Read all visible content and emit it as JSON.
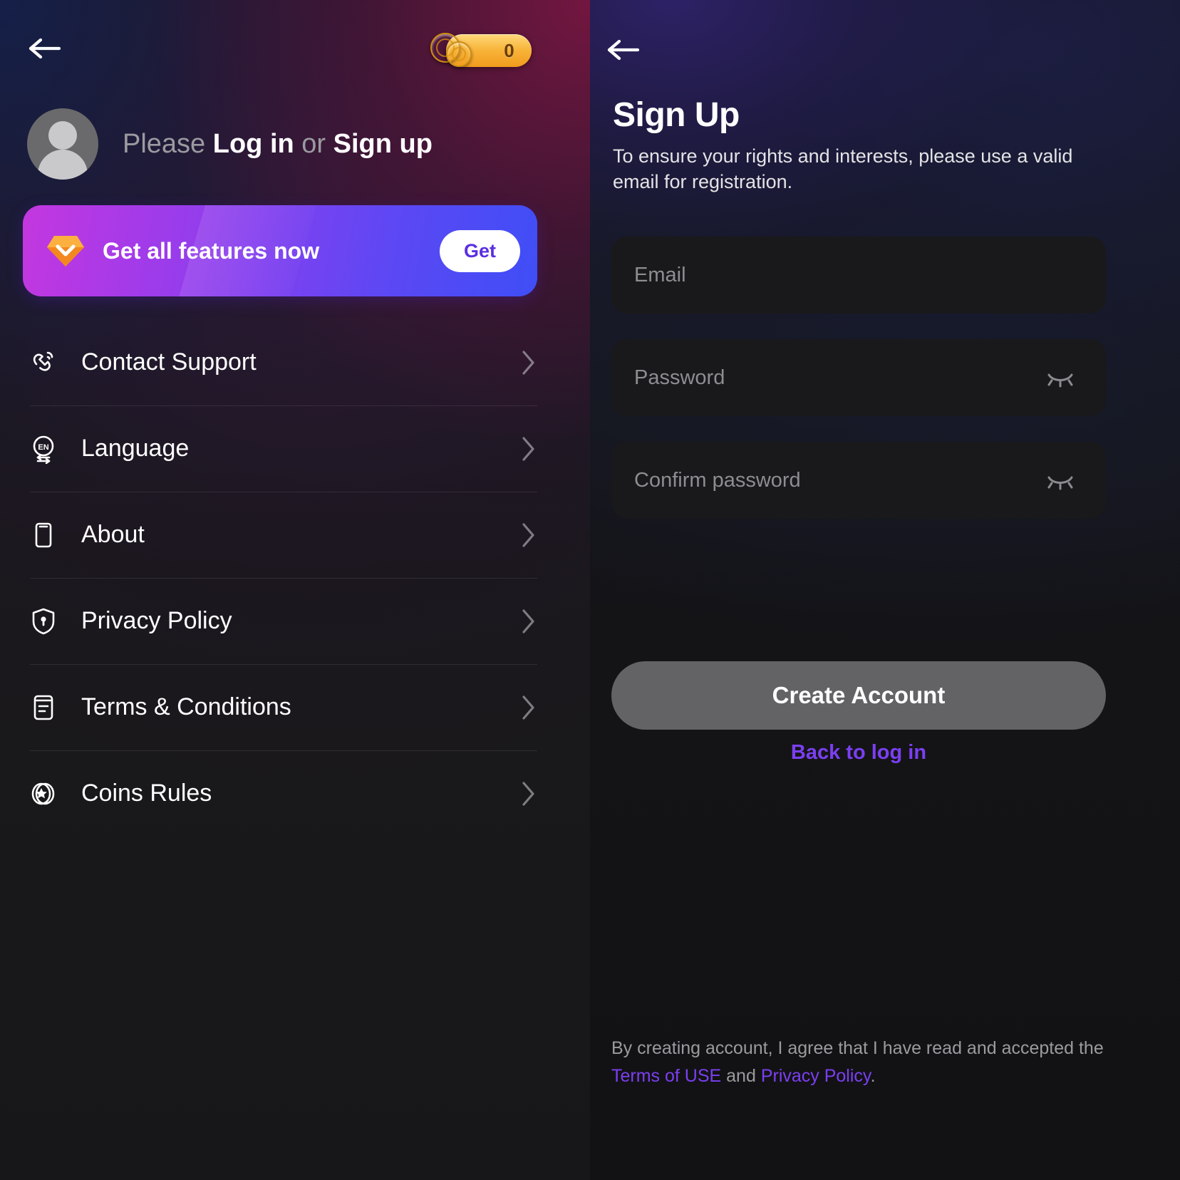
{
  "left_panel": {
    "back_icon": "arrow-left-icon",
    "coins": {
      "icon": "coin-stack-icon",
      "count": "0"
    },
    "account": {
      "avatar_icon": "user-avatar-placeholder-icon",
      "prefix": "Please ",
      "login_label": "Log in",
      "separator": " or ",
      "signup_label": "Sign up"
    },
    "promo": {
      "icon": "diamond-gem-icon",
      "label": "Get all features now",
      "button_label": "Get"
    },
    "menu": [
      {
        "icon": "headset-support-icon",
        "label": "Contact Support",
        "chevron": "chevron-right-icon"
      },
      {
        "icon": "language-en-icon",
        "label": "Language",
        "chevron": "chevron-right-icon"
      },
      {
        "icon": "phone-device-icon",
        "label": "About",
        "chevron": "chevron-right-icon"
      },
      {
        "icon": "shield-lock-icon",
        "label": "Privacy Policy",
        "chevron": "chevron-right-icon"
      },
      {
        "icon": "document-lines-icon",
        "label": "Terms & Conditions",
        "chevron": "chevron-right-icon"
      },
      {
        "icon": "coin-star-icon",
        "label": "Coins Rules",
        "chevron": "chevron-right-icon"
      }
    ]
  },
  "right_panel": {
    "back_icon": "arrow-left-icon",
    "title": "Sign Up",
    "subtitle": "To ensure your rights and interests, please use a valid email for registration.",
    "fields": {
      "email": {
        "placeholder": "Email",
        "value": ""
      },
      "password": {
        "placeholder": "Password",
        "value": "",
        "toggle_icon": "eye-off-icon"
      },
      "confirm": {
        "placeholder": "Confirm password",
        "value": "",
        "toggle_icon": "eye-off-icon"
      }
    },
    "create_button": "Create Account",
    "back_to_login": "Back to log in",
    "legal": {
      "text_before": "By creating account, I agree that I have read and accepted the ",
      "terms_link": "Terms of USE",
      "text_middle": " and ",
      "privacy_link": "Privacy Policy",
      "text_after": "."
    }
  },
  "colors": {
    "accent_purple": "#7b3ff2",
    "promo_start": "#c437df",
    "promo_end": "#3f4ef6",
    "coin_gold": "#f8b43a",
    "button_disabled": "#636365",
    "field_bg": "#19191b"
  }
}
